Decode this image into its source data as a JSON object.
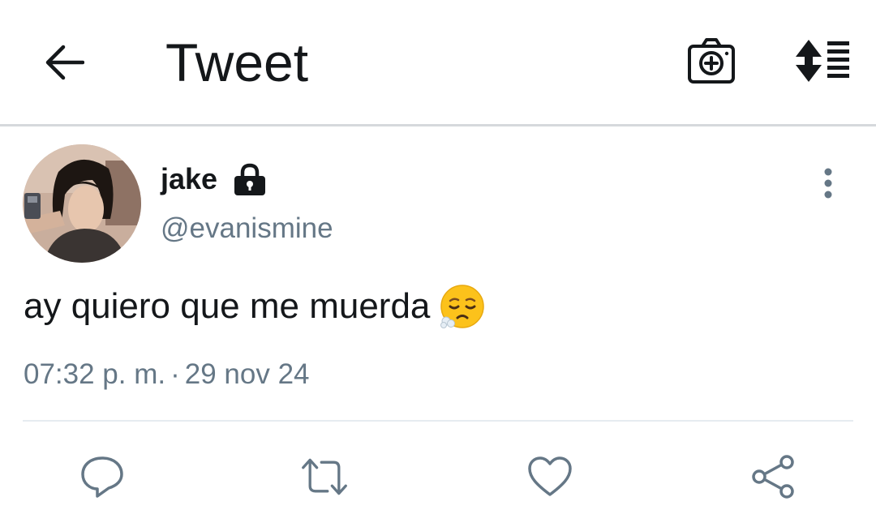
{
  "header": {
    "title": "Tweet",
    "back_icon": "arrow-left-icon",
    "camera_icon": "camera-plus-icon",
    "sort_icon": "sort-list-icon"
  },
  "tweet": {
    "author": {
      "display_name": "jake",
      "handle": "@evanismine",
      "protected_icon": "lock-icon",
      "avatar": "profile-photo"
    },
    "text": "ay quiero que me muerda",
    "emoji": "face-exhaling-emoji",
    "timestamp": {
      "time": "07:32 p. m.",
      "separator": "·",
      "date": "29 nov 24"
    },
    "more_icon": "more-vertical-icon"
  },
  "actions": [
    {
      "name": "reply",
      "icon": "reply-icon"
    },
    {
      "name": "retweet",
      "icon": "retweet-icon"
    },
    {
      "name": "like",
      "icon": "heart-icon"
    },
    {
      "name": "share",
      "icon": "share-icon"
    }
  ],
  "colors": {
    "text_primary": "#14171a",
    "text_secondary": "#657786",
    "divider": "#e6ecf0",
    "icon": "#657786"
  }
}
